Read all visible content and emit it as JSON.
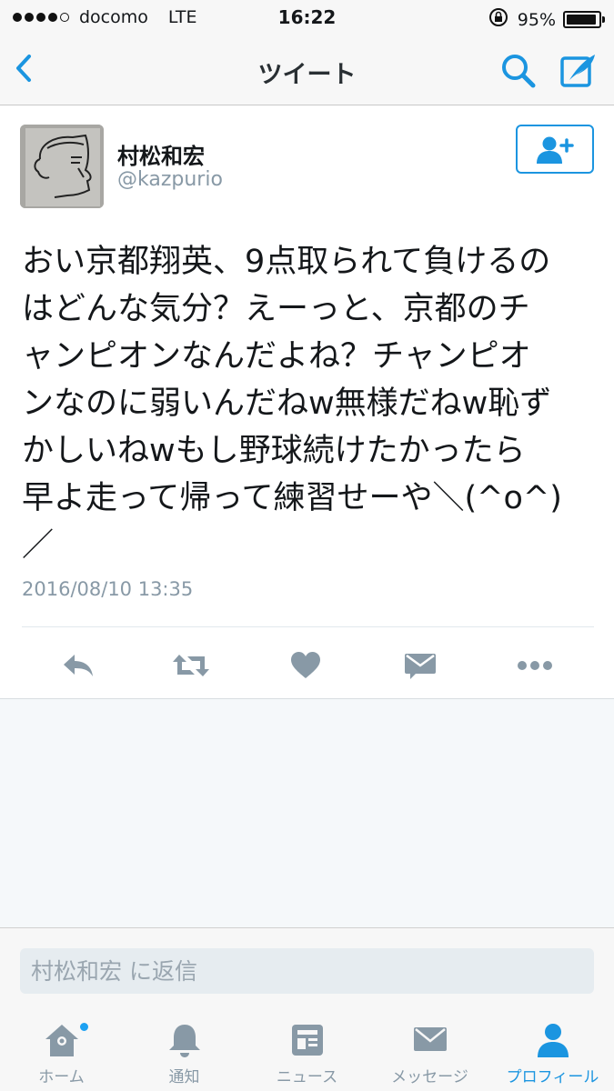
{
  "status_bar": {
    "carrier": "docomo",
    "network": "LTE",
    "time": "16:22",
    "battery": "95%",
    "battery_level": 0.95
  },
  "nav": {
    "title": "ツイート",
    "back_icon": "chevron-left-icon",
    "search_icon": "search-icon",
    "compose_icon": "compose-icon"
  },
  "tweet": {
    "user_name": "村松和宏",
    "handle": "@kazpurio",
    "text": "おい京都翔英、9点取られて負けるの\nはどんな気分？えーっと、京都のチ\nャンピオンなんだよね？チャンピオ\nンなのに弱いんだねw無様だねw恥ず\nかしいねwもし野球続けたかったら\n早よ走って帰って練習せーや＼(^o^)\n／",
    "timestamp": "2016/08/10 13:35"
  },
  "actions": [
    "reply-icon",
    "retweet-icon",
    "like-icon",
    "direct-message-icon",
    "more-icon"
  ],
  "reply": {
    "placeholder": "村松和宏 に返信"
  },
  "tab_bar": {
    "tabs": [
      {
        "label": "ホーム",
        "icon": "home-icon"
      },
      {
        "label": "通知",
        "icon": "bell-icon"
      },
      {
        "label": "ニュース",
        "icon": "news-icon"
      },
      {
        "label": "メッセージ",
        "icon": "envelope-icon"
      },
      {
        "label": "プロフィール",
        "icon": "person-icon"
      }
    ],
    "active": "プロフィール"
  },
  "colors": {
    "accent": "#1b95e0",
    "icon_gray": "#8899a6",
    "text": "#14171a"
  }
}
